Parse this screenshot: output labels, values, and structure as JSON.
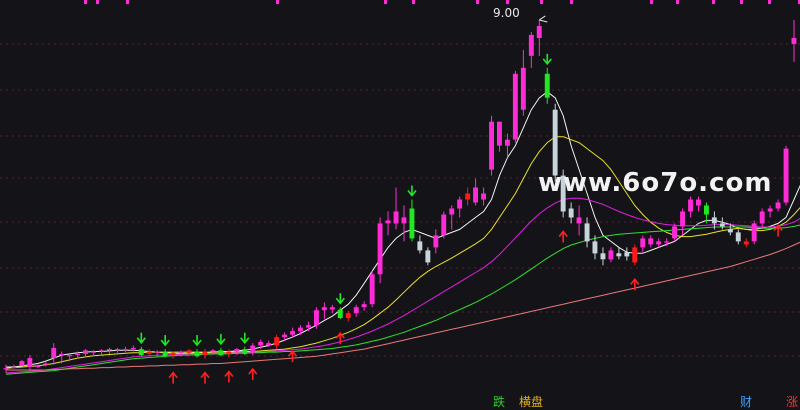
{
  "chart_data": {
    "type": "candlestick",
    "title": "",
    "xlabel": "",
    "ylabel": "",
    "ylim": [
      3.0,
      9.3
    ],
    "annotations": {
      "peak_price_label": "9.00"
    },
    "watermark": "www.6o7o.com",
    "candles": [
      [
        3.26,
        3.2,
        3.34,
        3.28,
        "m"
      ],
      [
        3.28,
        3.3,
        3.34,
        3.3,
        "m"
      ],
      [
        3.32,
        3.32,
        3.42,
        3.4,
        "m"
      ],
      [
        3.3,
        3.2,
        3.5,
        3.45,
        "m"
      ],
      [
        3.32,
        3.28,
        3.34,
        3.3,
        "m"
      ],
      [
        3.34,
        3.31,
        3.38,
        3.36,
        "m"
      ],
      [
        3.45,
        3.34,
        3.7,
        3.62,
        "m"
      ],
      [
        3.5,
        3.36,
        3.56,
        3.52,
        "m"
      ],
      [
        3.48,
        3.4,
        3.52,
        3.5,
        "m"
      ],
      [
        3.5,
        3.44,
        3.56,
        3.52,
        "m"
      ],
      [
        3.52,
        3.46,
        3.6,
        3.58,
        "m"
      ],
      [
        3.54,
        3.48,
        3.58,
        3.56,
        "m"
      ],
      [
        3.56,
        3.5,
        3.6,
        3.58,
        "m"
      ],
      [
        3.58,
        3.52,
        3.62,
        3.6,
        "m"
      ],
      [
        3.58,
        3.54,
        3.62,
        3.6,
        "m"
      ],
      [
        3.6,
        3.55,
        3.64,
        3.6,
        "m"
      ],
      [
        3.62,
        3.56,
        3.66,
        3.6,
        "m"
      ],
      [
        3.6,
        3.48,
        3.64,
        3.5,
        "g"
      ],
      [
        3.52,
        3.46,
        3.6,
        3.56,
        "r"
      ],
      [
        3.54,
        3.48,
        3.58,
        3.56,
        "m"
      ],
      [
        3.56,
        3.46,
        3.6,
        3.48,
        "g"
      ],
      [
        3.5,
        3.44,
        3.56,
        3.54,
        "r"
      ],
      [
        3.54,
        3.48,
        3.58,
        3.56,
        "m"
      ],
      [
        3.54,
        3.48,
        3.6,
        3.58,
        "r"
      ],
      [
        3.56,
        3.46,
        3.6,
        3.48,
        "g"
      ],
      [
        3.5,
        3.44,
        3.6,
        3.56,
        "r"
      ],
      [
        3.56,
        3.5,
        3.6,
        3.58,
        "m"
      ],
      [
        3.58,
        3.48,
        3.62,
        3.5,
        "g"
      ],
      [
        3.52,
        3.46,
        3.6,
        3.56,
        "r"
      ],
      [
        3.56,
        3.5,
        3.62,
        3.6,
        "m"
      ],
      [
        3.6,
        3.5,
        3.64,
        3.52,
        "g"
      ],
      [
        3.54,
        3.5,
        3.7,
        3.66,
        "m"
      ],
      [
        3.66,
        3.6,
        3.76,
        3.72,
        "m"
      ],
      [
        3.7,
        3.64,
        3.74,
        3.66,
        "m"
      ],
      [
        3.66,
        3.6,
        3.84,
        3.8,
        "r"
      ],
      [
        3.8,
        3.74,
        3.88,
        3.84,
        "m"
      ],
      [
        3.84,
        3.8,
        3.96,
        3.9,
        "m"
      ],
      [
        3.9,
        3.84,
        4.0,
        3.96,
        "m"
      ],
      [
        3.96,
        3.9,
        4.06,
        4.0,
        "m"
      ],
      [
        4.0,
        3.94,
        4.3,
        4.25,
        "m"
      ],
      [
        4.25,
        4.1,
        4.38,
        4.3,
        "m"
      ],
      [
        4.3,
        4.2,
        4.34,
        4.26,
        "m"
      ],
      [
        4.26,
        4.1,
        4.3,
        4.12,
        "g"
      ],
      [
        4.12,
        4.06,
        4.24,
        4.2,
        "r"
      ],
      [
        4.2,
        4.14,
        4.34,
        4.3,
        "m"
      ],
      [
        4.3,
        4.24,
        4.4,
        4.35,
        "m"
      ],
      [
        4.35,
        4.3,
        4.9,
        4.85,
        "m"
      ],
      [
        4.85,
        4.7,
        5.8,
        5.7,
        "m"
      ],
      [
        5.7,
        5.5,
        5.9,
        5.75,
        "m"
      ],
      [
        5.9,
        5.6,
        6.3,
        5.7,
        "m"
      ],
      [
        5.7,
        5.4,
        6.0,
        5.8,
        "m"
      ],
      [
        5.95,
        5.4,
        6.1,
        5.45,
        "g"
      ],
      [
        5.4,
        5.2,
        5.5,
        5.25,
        "w"
      ],
      [
        5.25,
        5.0,
        5.3,
        5.05,
        "w"
      ],
      [
        5.3,
        5.2,
        5.6,
        5.5,
        "m"
      ],
      [
        5.5,
        5.45,
        5.9,
        5.85,
        "m"
      ],
      [
        5.85,
        5.6,
        6.0,
        5.95,
        "m"
      ],
      [
        5.95,
        5.8,
        6.15,
        6.1,
        "m"
      ],
      [
        6.1,
        6.0,
        6.3,
        6.2,
        "r"
      ],
      [
        6.3,
        6.0,
        6.45,
        6.05,
        "m"
      ],
      [
        6.1,
        6.0,
        6.3,
        6.2,
        "m"
      ],
      [
        6.6,
        6.5,
        7.5,
        7.4,
        "m"
      ],
      [
        7.4,
        6.9,
        7.4,
        7.0,
        "m"
      ],
      [
        7.0,
        6.8,
        7.2,
        7.1,
        "m"
      ],
      [
        7.1,
        7.05,
        8.25,
        8.2,
        "m"
      ],
      [
        8.3,
        7.5,
        8.6,
        7.6,
        "m"
      ],
      [
        8.5,
        8.3,
        8.9,
        8.85,
        "m"
      ],
      [
        8.8,
        8.5,
        9.1,
        9.0,
        "m"
      ],
      [
        8.2,
        7.7,
        8.3,
        7.8,
        "g"
      ],
      [
        7.6,
        6.4,
        7.7,
        6.5,
        "w"
      ],
      [
        6.5,
        5.8,
        6.6,
        5.9,
        "w"
      ],
      [
        5.95,
        5.7,
        6.05,
        5.8,
        "w"
      ],
      [
        5.8,
        5.5,
        6.0,
        5.7,
        "m"
      ],
      [
        5.7,
        5.3,
        5.8,
        5.4,
        "w"
      ],
      [
        5.4,
        5.1,
        5.5,
        5.2,
        "w"
      ],
      [
        5.2,
        5.0,
        5.3,
        5.1,
        "w"
      ],
      [
        5.1,
        5.05,
        5.3,
        5.25,
        "m"
      ],
      [
        5.2,
        5.1,
        5.3,
        5.15,
        "w"
      ],
      [
        5.15,
        5.08,
        5.3,
        5.22,
        "w"
      ],
      [
        5.05,
        5.0,
        5.35,
        5.3,
        "r"
      ],
      [
        5.3,
        5.2,
        5.5,
        5.45,
        "m"
      ],
      [
        5.45,
        5.3,
        5.5,
        5.35,
        "m"
      ],
      [
        5.35,
        5.3,
        5.45,
        5.4,
        "m"
      ],
      [
        5.4,
        5.32,
        5.45,
        5.38,
        "m"
      ],
      [
        5.45,
        5.4,
        5.7,
        5.65,
        "m"
      ],
      [
        5.65,
        5.5,
        5.95,
        5.9,
        "m"
      ],
      [
        5.9,
        5.8,
        6.15,
        6.1,
        "m"
      ],
      [
        6.1,
        5.9,
        6.15,
        6.0,
        "m"
      ],
      [
        6.0,
        5.7,
        6.05,
        5.85,
        "g"
      ],
      [
        5.8,
        5.6,
        5.9,
        5.7,
        "w"
      ],
      [
        5.7,
        5.6,
        5.8,
        5.65,
        "w"
      ],
      [
        5.6,
        5.5,
        5.7,
        5.55,
        "w"
      ],
      [
        5.55,
        5.35,
        5.6,
        5.4,
        "w"
      ],
      [
        5.35,
        5.3,
        5.45,
        5.4,
        "r"
      ],
      [
        5.4,
        5.35,
        5.75,
        5.7,
        "m"
      ],
      [
        5.7,
        5.6,
        5.95,
        5.9,
        "m"
      ],
      [
        5.9,
        5.8,
        6.0,
        5.95,
        "m"
      ],
      [
        5.95,
        5.9,
        6.1,
        6.05,
        "m"
      ],
      [
        6.05,
        6.0,
        7.0,
        6.95,
        "m"
      ],
      [
        8.7,
        8.4,
        9.1,
        8.8,
        "m"
      ]
    ],
    "ma_lines": [
      {
        "color": "#f2f2f2",
        "values": [
          3.3,
          3.3,
          3.32,
          3.34,
          3.36,
          3.4,
          3.45,
          3.5,
          3.52,
          3.54,
          3.55,
          3.56,
          3.56,
          3.57,
          3.58,
          3.58,
          3.58,
          3.57,
          3.56,
          3.55,
          3.54,
          3.53,
          3.53,
          3.53,
          3.54,
          3.54,
          3.55,
          3.56,
          3.56,
          3.57,
          3.58,
          3.6,
          3.63,
          3.66,
          3.7,
          3.75,
          3.8,
          3.86,
          3.93,
          4.0,
          4.08,
          4.15,
          4.25,
          4.35,
          4.5,
          4.7,
          4.9,
          5.1,
          5.3,
          5.45,
          5.55,
          5.6,
          5.55,
          5.5,
          5.45,
          5.5,
          5.55,
          5.6,
          5.7,
          5.8,
          5.9,
          6.1,
          6.5,
          6.8,
          7.0,
          7.3,
          7.6,
          7.8,
          7.9,
          7.8,
          7.5,
          7.0,
          6.6,
          6.2,
          5.8,
          5.5,
          5.4,
          5.3,
          5.22,
          5.2,
          5.2,
          5.25,
          5.3,
          5.35,
          5.4,
          5.5,
          5.6,
          5.7,
          5.75,
          5.75,
          5.72,
          5.68,
          5.62,
          5.6,
          5.6,
          5.62,
          5.65,
          5.7,
          5.8,
          6.1,
          6.4
        ]
      },
      {
        "color": "#e8e02a",
        "values": [
          3.28,
          3.29,
          3.3,
          3.31,
          3.32,
          3.34,
          3.36,
          3.39,
          3.42,
          3.45,
          3.47,
          3.49,
          3.5,
          3.51,
          3.52,
          3.53,
          3.54,
          3.54,
          3.55,
          3.55,
          3.55,
          3.55,
          3.55,
          3.55,
          3.55,
          3.55,
          3.55,
          3.55,
          3.55,
          3.55,
          3.56,
          3.56,
          3.57,
          3.58,
          3.59,
          3.6,
          3.62,
          3.64,
          3.67,
          3.7,
          3.74,
          3.78,
          3.83,
          3.88,
          3.94,
          4.01,
          4.1,
          4.2,
          4.3,
          4.42,
          4.55,
          4.68,
          4.8,
          4.9,
          4.98,
          5.05,
          5.12,
          5.2,
          5.28,
          5.36,
          5.45,
          5.6,
          5.8,
          6.0,
          6.2,
          6.45,
          6.7,
          6.9,
          7.05,
          7.15,
          7.15,
          7.1,
          7.05,
          6.95,
          6.85,
          6.75,
          6.6,
          6.4,
          6.2,
          6.0,
          5.85,
          5.72,
          5.62,
          5.55,
          5.5,
          5.48,
          5.48,
          5.5,
          5.52,
          5.55,
          5.58,
          5.6,
          5.62,
          5.6,
          5.58,
          5.58,
          5.6,
          5.65,
          5.72,
          5.85,
          6.0
        ]
      },
      {
        "color": "#e020e0",
        "values": [
          3.2,
          3.21,
          3.22,
          3.23,
          3.24,
          3.25,
          3.27,
          3.29,
          3.31,
          3.33,
          3.35,
          3.37,
          3.39,
          3.41,
          3.43,
          3.45,
          3.47,
          3.48,
          3.49,
          3.5,
          3.5,
          3.51,
          3.51,
          3.52,
          3.52,
          3.52,
          3.53,
          3.53,
          3.53,
          3.54,
          3.54,
          3.55,
          3.55,
          3.56,
          3.57,
          3.58,
          3.59,
          3.6,
          3.62,
          3.64,
          3.66,
          3.69,
          3.72,
          3.76,
          3.8,
          3.85,
          3.9,
          3.96,
          4.02,
          4.09,
          4.16,
          4.24,
          4.32,
          4.4,
          4.48,
          4.56,
          4.64,
          4.72,
          4.8,
          4.88,
          4.96,
          5.06,
          5.18,
          5.32,
          5.46,
          5.6,
          5.74,
          5.86,
          5.96,
          6.04,
          6.1,
          6.12,
          6.12,
          6.1,
          6.06,
          6.02,
          5.96,
          5.9,
          5.85,
          5.8,
          5.76,
          5.73,
          5.7,
          5.68,
          5.67,
          5.66,
          5.66,
          5.66,
          5.67,
          5.68,
          5.68,
          5.68,
          5.67,
          5.66,
          5.65,
          5.64,
          5.64,
          5.65,
          5.68,
          5.72,
          5.8
        ]
      },
      {
        "color": "#2ee02e",
        "values": [
          3.18,
          3.19,
          3.2,
          3.21,
          3.22,
          3.23,
          3.24,
          3.26,
          3.28,
          3.3,
          3.32,
          3.34,
          3.36,
          3.38,
          3.4,
          3.42,
          3.44,
          3.45,
          3.46,
          3.47,
          3.48,
          3.49,
          3.5,
          3.5,
          3.51,
          3.51,
          3.52,
          3.52,
          3.52,
          3.53,
          3.53,
          3.54,
          3.54,
          3.55,
          3.55,
          3.56,
          3.56,
          3.57,
          3.58,
          3.59,
          3.6,
          3.61,
          3.63,
          3.65,
          3.67,
          3.7,
          3.73,
          3.76,
          3.8,
          3.84,
          3.88,
          3.93,
          3.98,
          4.03,
          4.08,
          4.14,
          4.2,
          4.26,
          4.32,
          4.38,
          4.45,
          4.52,
          4.6,
          4.68,
          4.76,
          4.85,
          4.94,
          5.03,
          5.12,
          5.2,
          5.28,
          5.34,
          5.38,
          5.42,
          5.45,
          5.48,
          5.5,
          5.52,
          5.53,
          5.54,
          5.55,
          5.56,
          5.57,
          5.58,
          5.59,
          5.6,
          5.61,
          5.62,
          5.63,
          5.64,
          5.64,
          5.64,
          5.64,
          5.64,
          5.63,
          5.62,
          5.62,
          5.62,
          5.63,
          5.65,
          5.68
        ]
      },
      {
        "color": "#e87878",
        "values": [
          3.25,
          3.25,
          3.25,
          3.25,
          3.25,
          3.25,
          3.26,
          3.26,
          3.27,
          3.27,
          3.28,
          3.28,
          3.29,
          3.29,
          3.3,
          3.3,
          3.31,
          3.31,
          3.32,
          3.32,
          3.33,
          3.33,
          3.34,
          3.34,
          3.35,
          3.35,
          3.36,
          3.36,
          3.37,
          3.38,
          3.39,
          3.4,
          3.41,
          3.42,
          3.43,
          3.44,
          3.45,
          3.46,
          3.47,
          3.48,
          3.5,
          3.52,
          3.54,
          3.56,
          3.58,
          3.6,
          3.63,
          3.66,
          3.69,
          3.72,
          3.75,
          3.78,
          3.81,
          3.84,
          3.87,
          3.9,
          3.93,
          3.96,
          3.99,
          4.02,
          4.05,
          4.08,
          4.11,
          4.14,
          4.17,
          4.2,
          4.23,
          4.26,
          4.29,
          4.32,
          4.35,
          4.38,
          4.41,
          4.44,
          4.47,
          4.5,
          4.53,
          4.56,
          4.59,
          4.62,
          4.65,
          4.68,
          4.71,
          4.74,
          4.77,
          4.8,
          4.83,
          4.86,
          4.89,
          4.92,
          4.95,
          4.98,
          5.02,
          5.06,
          5.1,
          5.14,
          5.18,
          5.23,
          5.28,
          5.34,
          5.4
        ]
      }
    ],
    "up_arrows": [
      21,
      25,
      28,
      31,
      36,
      42,
      70,
      79,
      97
    ],
    "green_arrows": [
      17,
      20,
      24,
      27,
      30,
      42,
      51,
      68
    ],
    "bottom_signals": [
      {
        "text": "跌",
        "color": "#2ed02e",
        "index": 62
      },
      {
        "text": "横盘",
        "color": "#e0b020",
        "index": 66
      },
      {
        "text": "财",
        "color": "#3aa0ff",
        "index": 93
      },
      {
        "text": "涨",
        "color": "#ff3030",
        "index": 106
      }
    ]
  }
}
